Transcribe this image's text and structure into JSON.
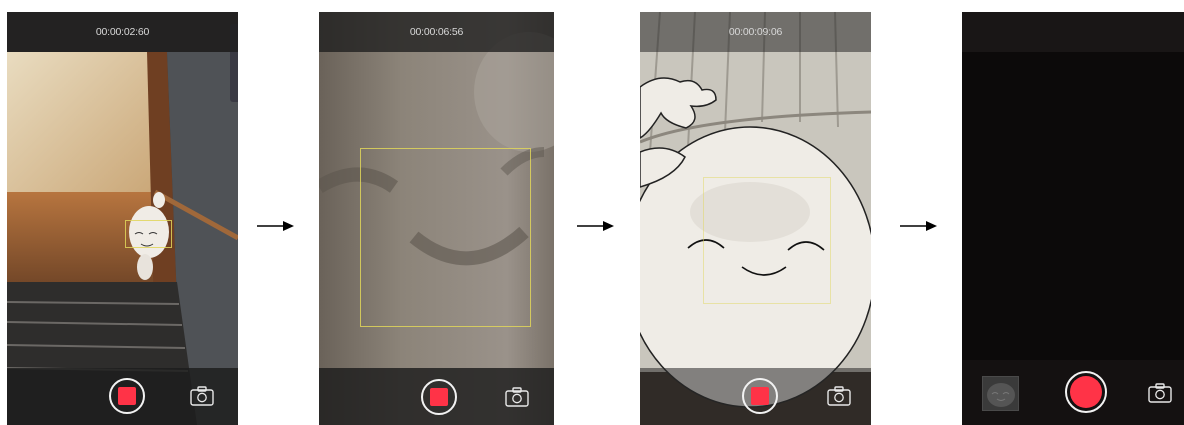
{
  "screens": [
    {
      "timer": "00:00:02:60",
      "record_state": "recording"
    },
    {
      "timer": "00:00:06:56",
      "record_state": "recording"
    },
    {
      "timer": "00:00:09:06",
      "record_state": "recording"
    },
    {
      "timer": "",
      "record_state": "idle"
    }
  ],
  "icons": {
    "record": "stop-record-icon",
    "record_idle": "record-icon",
    "camera_switch": "camera-switch-icon",
    "arrow": "right-arrow-icon"
  },
  "colors": {
    "record_red": "#ff3347",
    "bar_dark": "#1e1e1e",
    "focus_yellow": "#e0d65a"
  }
}
